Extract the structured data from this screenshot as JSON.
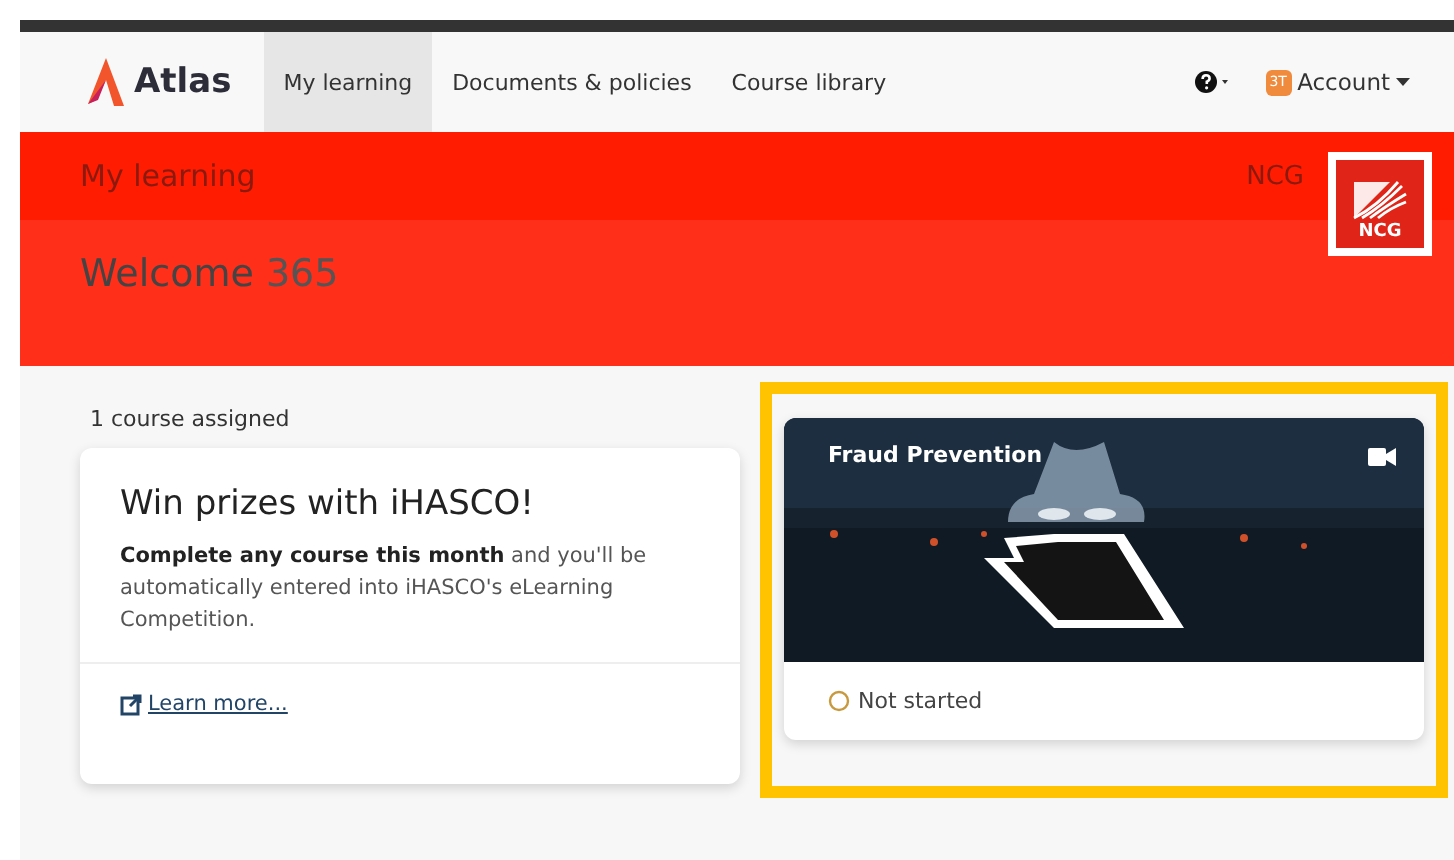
{
  "brand": {
    "name": "Atlas"
  },
  "nav": [
    {
      "label": "My learning",
      "selected": true
    },
    {
      "label": "Documents & policies",
      "selected": false
    },
    {
      "label": "Course library",
      "selected": false
    }
  ],
  "account": {
    "initials": "3T",
    "label": "Account"
  },
  "header": {
    "section": "My learning",
    "org": "NCG",
    "logo": "NCG",
    "welcome": "Welcome",
    "user": "365"
  },
  "assigned": "1 course assigned",
  "promo": {
    "title": "Win prizes with iHASCO!",
    "body": "**Complete any course this month** and you'll be automatically entered into iHASCO's eLearning Competition.",
    "link": "Learn more..."
  },
  "courses": [
    {
      "title": "Fraud Prevention",
      "status": "Not started",
      "highlighted": true
    }
  ]
}
